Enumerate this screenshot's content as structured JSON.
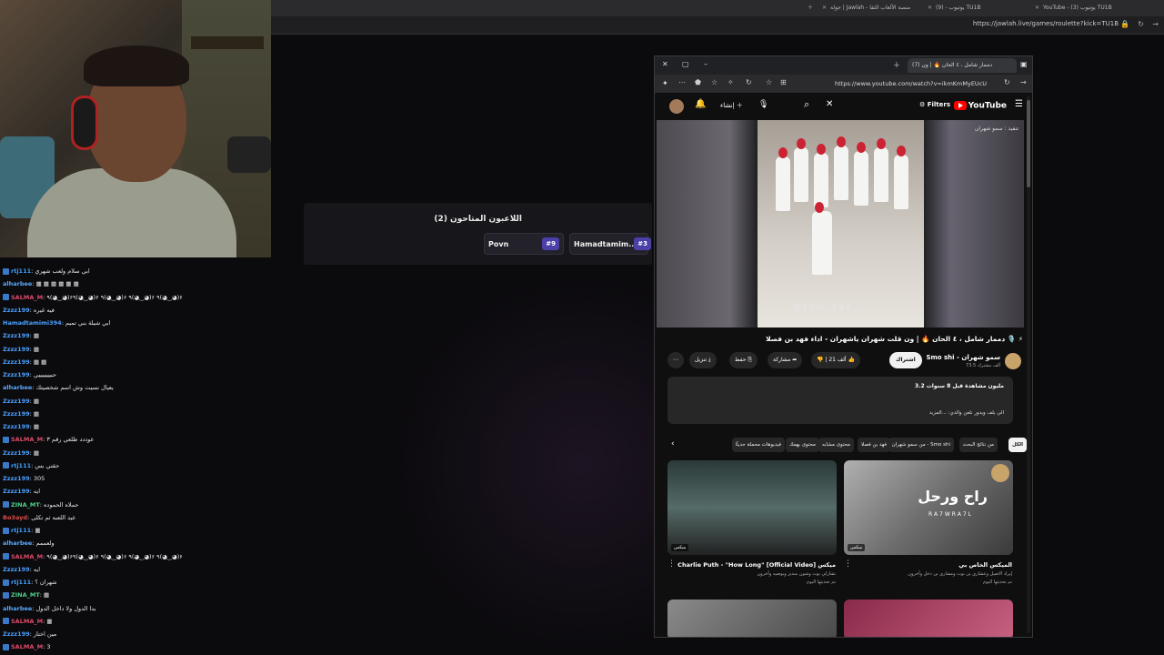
{
  "browser": {
    "tabs": [
      {
        "label": "YouTube - يوتيوب (3) TU1B"
      },
      {
        "label": "يوتيوب - (9) TU1B"
      },
      {
        "label": "جولة | Jawlah - منصة الألعاب الثقا"
      }
    ],
    "url": "https://jawlah.live/games/roulette?kick=TU1B"
  },
  "players": {
    "title": "اللاعبون المتاحون (2)",
    "list": [
      {
        "name": "Povn",
        "rank": "#9"
      },
      {
        "name": "Hamadtamim..",
        "rank": "#3"
      }
    ]
  },
  "chat": [
    {
      "user": "rtj111",
      "color": "#3fa0ff",
      "badge": true,
      "msg": ": ابي سلام ولعب شهري"
    },
    {
      "user": "alharbee",
      "color": "#5aa9ff",
      "badge": false,
      "msg": ": ▦ ▦ ▦ ▦ ▦ ▦"
    },
    {
      "user": "SALMA_M",
      "color": "#e04a6a",
      "badge": true,
      "msg": ": ٩(◕‿◕)۶٩(◕‿◕)۶ ٩(◕‿◕)۶ ٩(◕‿◕)۶ ٩(◕‿◕)۶"
    },
    {
      "user": "Zzzz199",
      "color": "#4aa0ff",
      "badge": false,
      "msg": ": فيه غيره"
    },
    {
      "user": "Hamadtamimi394",
      "color": "#4aa0ff",
      "badge": false,
      "msg": ": ابي شيلة بني تميم"
    },
    {
      "user": "Zzzz199",
      "color": "#4aa0ff",
      "badge": false,
      "msg": ": ▦"
    },
    {
      "user": "Zzzz199",
      "color": "#4aa0ff",
      "badge": false,
      "msg": ": ▦"
    },
    {
      "user": "Zzzz199",
      "color": "#4aa0ff",
      "badge": false,
      "msg": ": ▦ ▦"
    },
    {
      "user": "Zzzz199",
      "color": "#4aa0ff",
      "badge": false,
      "msg": ": حبيييييييي"
    },
    {
      "user": "alharbee",
      "color": "#5aa9ff",
      "badge": false,
      "msg": ": يعيال نسيت وش اسم شخصيتك"
    },
    {
      "user": "Zzzz199",
      "color": "#4aa0ff",
      "badge": false,
      "msg": ": ▦"
    },
    {
      "user": "Zzzz199",
      "color": "#4aa0ff",
      "badge": false,
      "msg": ": ▦"
    },
    {
      "user": "Zzzz199",
      "color": "#4aa0ff",
      "badge": false,
      "msg": ": ▦"
    },
    {
      "user": "SALMA_M",
      "color": "#e04a6a",
      "badge": true,
      "msg": ": عوددد طلعي رقم ٣"
    },
    {
      "user": "Zzzz199",
      "color": "#4aa0ff",
      "badge": false,
      "msg": ": ▦"
    },
    {
      "user": "rtj111",
      "color": "#3fa0ff",
      "badge": true,
      "msg": ": حقتي بس"
    },
    {
      "user": "Zzzz199",
      "color": "#4aa0ff",
      "badge": false,
      "msg": ": 305"
    },
    {
      "user": "Zzzz199",
      "color": "#4aa0ff",
      "badge": false,
      "msg": ": ايه"
    },
    {
      "user": "ZINA_MT",
      "color": "#4fd08a",
      "badge": true,
      "msg": ": حملاه الحموده"
    },
    {
      "user": "Bo3ayd",
      "color": "#e04a4a",
      "badge": false,
      "msg": ": عيد اللعبه ثم تكلى"
    },
    {
      "user": "rtj111",
      "color": "#3fa0ff",
      "badge": true,
      "msg": ": ▦"
    },
    {
      "user": "alharbee",
      "color": "#5aa9ff",
      "badge": false,
      "msg": ": ولعممم"
    },
    {
      "user": "SALMA_M",
      "color": "#e04a6a",
      "badge": true,
      "msg": ": ٩(◕‿◕)۶٩(◕‿◕)۶ ٩(◕‿◕)۶ ٩(◕‿◕)۶ ٩(◕‿◕)۶"
    },
    {
      "user": "Zzzz199",
      "color": "#4aa0ff",
      "badge": false,
      "msg": ": ايه"
    },
    {
      "user": "rtj111",
      "color": "#3fa0ff",
      "badge": true,
      "msg": ": شهران ؟"
    },
    {
      "user": "ZINA_MT",
      "color": "#4fd08a",
      "badge": true,
      "msg": ": ▦"
    },
    {
      "user": "alharbee",
      "color": "#5aa9ff",
      "badge": false,
      "msg": ": بدا الدول ولا داخل الدول"
    },
    {
      "user": "SALMA_M",
      "color": "#e04a6a",
      "badge": true,
      "msg": ": ▦"
    },
    {
      "user": "Zzzz199",
      "color": "#4aa0ff",
      "badge": false,
      "msg": ": مين اختار"
    },
    {
      "user": "SALMA_M",
      "color": "#e04a6a",
      "badge": true,
      "msg": ": 3"
    }
  ],
  "yt_window": {
    "tab_label": "(7) دممار شامل ، ٤ الحان 🔥 | ون",
    "url": "https://www.youtube.com/watch?v=ikmKmMyEUcU",
    "logo": "YouTube",
    "filters": "Filters",
    "create": "إنشاء",
    "video": {
      "watermark": "@smo_5o7",
      "corner_badge": "تنفيذ : سمو شهران"
    },
    "title": "دممار شامل ، ٤ الحان 🔥 | ون قلت شهران ياشهران - اداء فهد بن فصلا 🎙️ ⚡",
    "channel": {
      "name": "Smo shi - سمو شهران",
      "subs": "73.5 ألف مشترك",
      "subscribe": "اشتراك"
    },
    "actions": {
      "likes": "21 ألف",
      "share": "مشاركة",
      "save": "حفظ",
      "download": "تنزيل",
      "more": "⋯"
    },
    "description": {
      "views": "3.2 مليون مشاهدة قبل 8 سنوات",
      "text": "الي يلف ويدور نلعن والدي: ...المزيد"
    },
    "chips": [
      {
        "label": "الكل",
        "active": true
      },
      {
        "label": "من نتائج البحث",
        "active": false
      },
      {
        "label": "من سمو شهران - Smo shi",
        "active": false
      },
      {
        "label": "فهد بن فصلا",
        "active": false
      },
      {
        "label": "محتوى مشابه",
        "active": false
      },
      {
        "label": "محتوى يهمك",
        "active": false
      },
      {
        "label": "فيديوهات محملة حديثًا",
        "active": false
      }
    ],
    "recommendations": [
      {
        "title": "Charlie Puth - \"How Long\" [Official Video] ميكس",
        "meta1": "تشارلي بوث وشون منديز ويوصيه وآخرون",
        "meta2": "تم تحديثها اليوم",
        "badge": "ميكس"
      },
      {
        "title": "الميكس الخاص بي",
        "meta1": "إيراد الاصيل وعشاري بن نوت ومشاري بن دخل وآخرون",
        "meta2": "تم تحديثها اليوم",
        "badge": "ميكس",
        "art": "راح ورحل",
        "art_sub": "RA7WRA7L"
      }
    ]
  }
}
